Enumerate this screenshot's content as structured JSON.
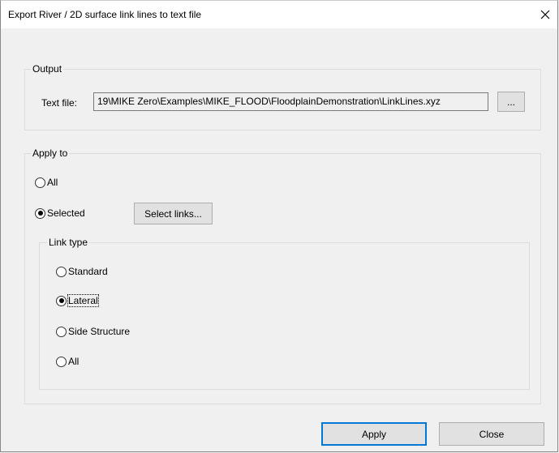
{
  "window": {
    "title": "Export River / 2D surface link lines to text file",
    "close_glyph": "✕"
  },
  "output": {
    "legend": "Output",
    "text_file_label": "Text file:",
    "text_file_value": "19\\MIKE Zero\\Examples\\MIKE_FLOOD\\FloodplainDemonstration\\LinkLines.xyz",
    "browse_label": "..."
  },
  "apply_to": {
    "legend": "Apply to",
    "options": [
      {
        "label": "All",
        "selected": false
      },
      {
        "label": "Selected",
        "selected": true
      }
    ],
    "select_links_label": "Select links..."
  },
  "link_type": {
    "legend": "Link type",
    "options": [
      {
        "label": "Standard",
        "selected": false
      },
      {
        "label": "Lateral",
        "selected": true
      },
      {
        "label": "Side Structure",
        "selected": false
      },
      {
        "label": "All",
        "selected": false
      }
    ]
  },
  "footer": {
    "apply_label": "Apply",
    "close_label": "Close"
  }
}
